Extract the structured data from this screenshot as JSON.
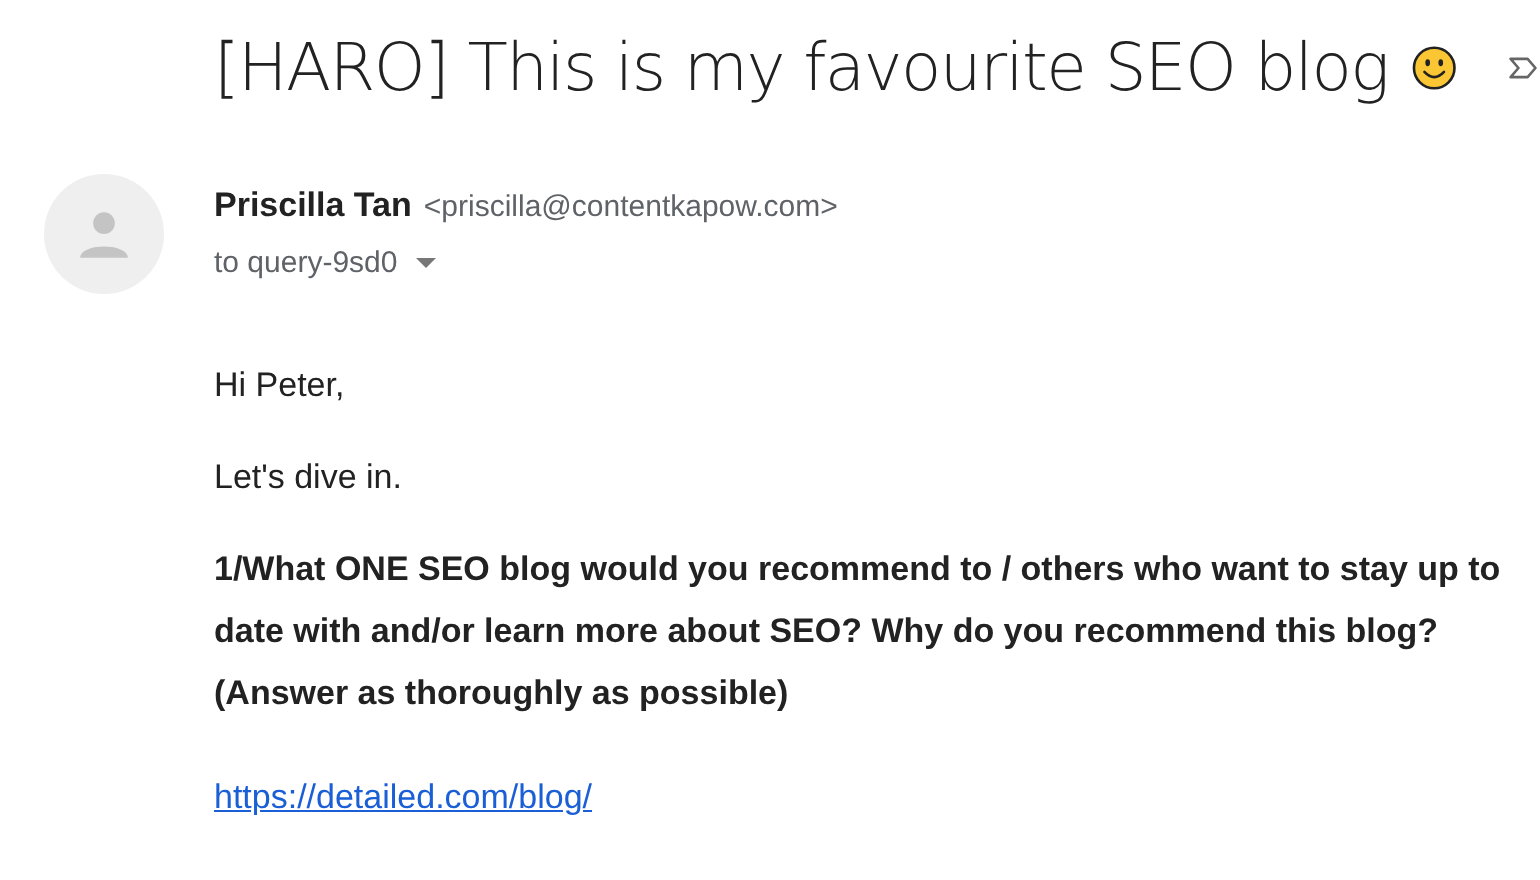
{
  "subject": "[HARO] This is my favourite SEO blog",
  "sender": {
    "name": "Priscilla Tan",
    "email": "<priscilla@contentkapow.com>",
    "recipient": "to query-9sd0"
  },
  "body": [
    {
      "kind": "text",
      "text": "Hi Peter,"
    },
    {
      "kind": "text",
      "text": "Let's dive in."
    },
    {
      "kind": "bold",
      "text": "1/What ONE SEO blog would you recommend to / others who want to stay up to date with and/or learn more about SEO? Why do you recommend this blog? (Answer as thoroughly as possible)"
    },
    {
      "kind": "link",
      "text": "https://detailed.com/blog/"
    }
  ]
}
